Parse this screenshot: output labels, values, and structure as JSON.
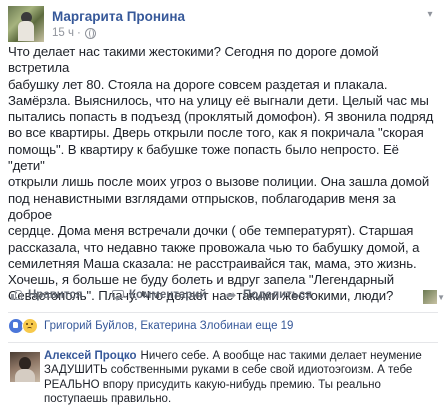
{
  "post": {
    "author": "Маргарита Пронина",
    "time": "15 ч",
    "text_lines": [
      "Что делает нас такими жестокими? Сегодня по дороге домой встретила",
      "бабушку лет 80. Стояла на дороге совсем раздетая и плакала.",
      "Замёрзла. Выяснилось, что на улицу её выгнали дети. Целый час мы",
      "пытались попасть в подъезд (проклятый домофон). Я звонила подряд",
      "во все квартиры. Дверь открыли после того, как я покричала \"скорая",
      "помощь\". В квартиру к бабушке тоже попасть было непросто. Её \"дети\"",
      "открыли лишь после моих угроз о вызове полиции. Она зашла домой",
      "под ненавистными взглядами отпрысков, поблагодарив меня за доброе",
      "сердце. Дома меня встречали дочки ( обе температурят). Старшая",
      "рассказала, что недавно также провожала чью то бабушку домой, а",
      "семилетняя Маша сказала: не расстраивайся так, мама, это жизнь.",
      "Хочешь, я больше не буду болеть и вдруг запела \"Легендарный",
      "Севастополь\". Плачу. Что делает нас такими жестокими, люди?"
    ]
  },
  "actions": {
    "like": "Нравится",
    "comment": "Комментарий",
    "share": "Поделиться"
  },
  "reactions": {
    "names": "Григорий Буйлов, Екатерина Злобина",
    "rest": " и еще 19"
  },
  "comment": {
    "author": "Алексей Процко",
    "text": "Ничего себе. А вообще нас такими делает неумение ЗАДУШИТЬ собственными руками в себе свой идиотоэгоизм. А тебе РЕАЛЬНО впору присудить какую-нибудь премию. Ты реально поступаешь правильно."
  },
  "colors": {
    "link": "#365899",
    "text": "#1d2129",
    "muted": "#90949c"
  }
}
